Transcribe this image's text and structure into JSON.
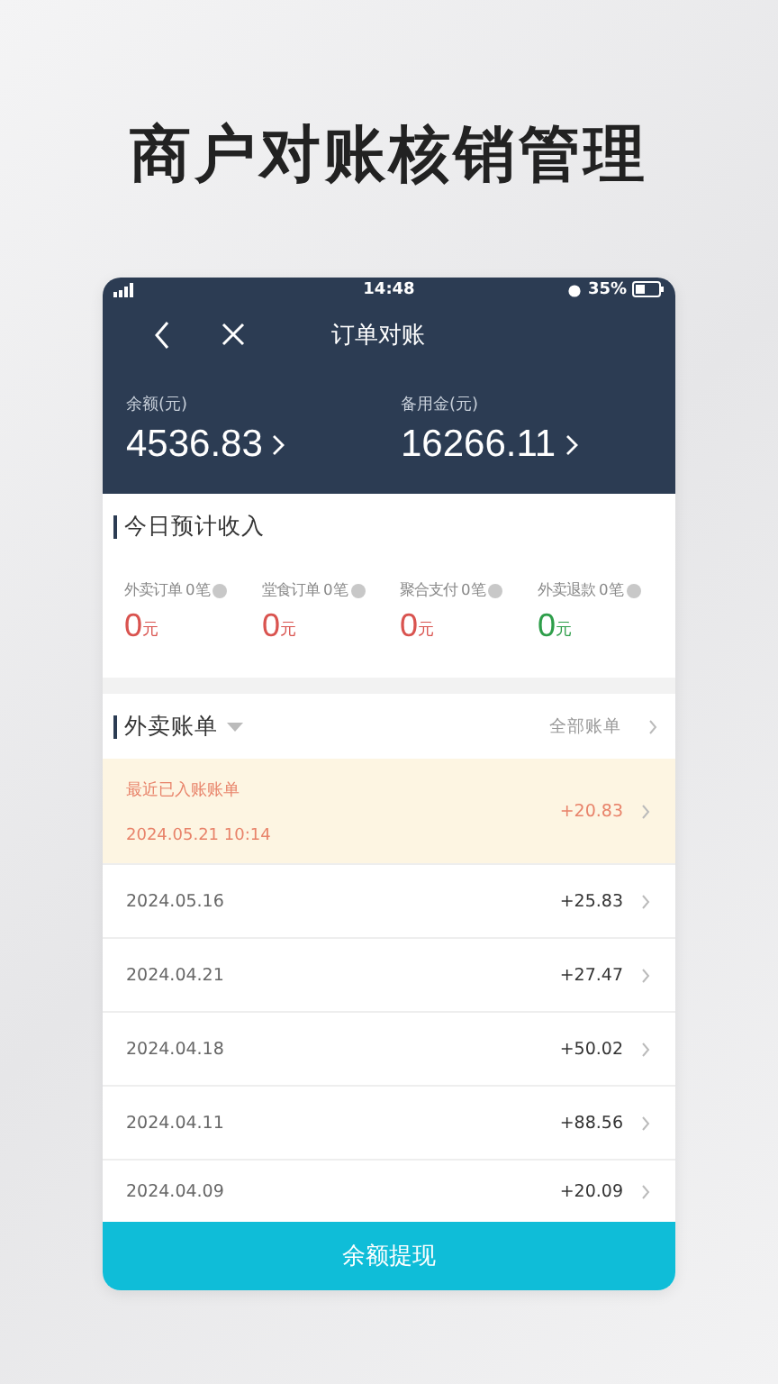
{
  "headline": "商户对账核销管理",
  "status_bar": {
    "time": "14:48",
    "battery": "35%"
  },
  "nav": {
    "title": "订单对账"
  },
  "balances": [
    {
      "label": "余额(元)",
      "value": "4536.83"
    },
    {
      "label": "备用金(元)",
      "value": "16266.11"
    }
  ],
  "today": {
    "title": "今日预计收入",
    "stats": [
      {
        "label": "外卖订单",
        "count": "0笔",
        "amount": "0",
        "unit": "元",
        "color": "#d9534f"
      },
      {
        "label": "堂食订单",
        "count": "0笔",
        "amount": "0",
        "unit": "元",
        "color": "#d9534f"
      },
      {
        "label": "聚合支付",
        "count": "0笔",
        "amount": "0",
        "unit": "元",
        "color": "#d9534f"
      },
      {
        "label": "外卖退款",
        "count": "0笔",
        "amount": "0",
        "unit": "元",
        "color": "#2e9e4a"
      }
    ]
  },
  "bills": {
    "title": "外卖账单",
    "all_link": "全部账单",
    "rows": [
      {
        "kind": "recent",
        "title": "最近已入账账单",
        "date": "2024.05.21 10:14",
        "amount": "+20.83"
      },
      {
        "kind": "normal",
        "date": "2024.05.16",
        "amount": "+25.83"
      },
      {
        "kind": "normal",
        "date": "2024.04.21",
        "amount": "+27.47"
      },
      {
        "kind": "normal",
        "date": "2024.04.18",
        "amount": "+50.02"
      },
      {
        "kind": "normal",
        "date": "2024.04.11",
        "amount": "+88.56"
      },
      {
        "kind": "normal",
        "date": "2024.04.09",
        "amount": "+20.09"
      }
    ]
  },
  "withdraw_button": "余额提现"
}
